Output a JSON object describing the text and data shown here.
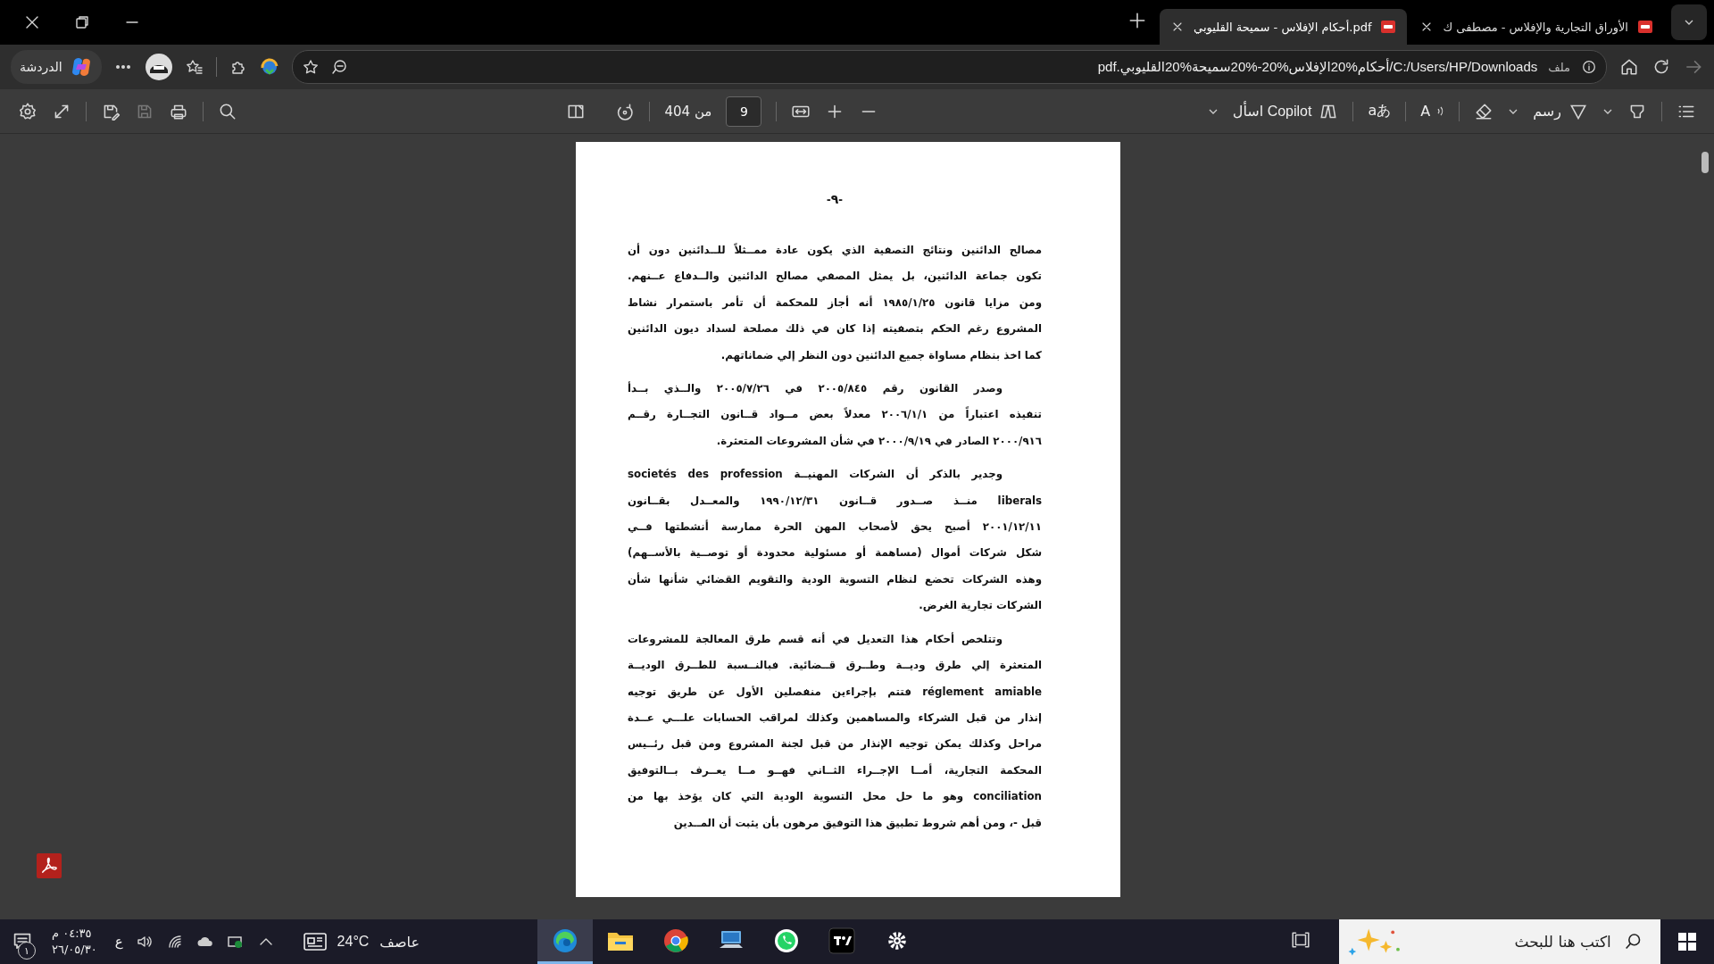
{
  "tabs": [
    {
      "title": "الأوراق التجارية والإفلاس - مصطفى ك",
      "selected": false
    },
    {
      "title": "أحكام الإفلاس - سميحة القليوبي.pdf",
      "selected": true
    }
  ],
  "address_bar": {
    "chat_label": "الدردشة",
    "url": "C:/Users/HP/Downloads/أحكام%20الإفلاس%20-%20سميحة%20القليوبي.pdf",
    "scheme_label": "ملف",
    "forward_disabled": true
  },
  "pdf_toolbar": {
    "save_disabled": true,
    "page_total": "من 404",
    "page_value": "9",
    "copilot_label": "اسأل Copilot",
    "translate_label": "aあ",
    "read_aloud_label": "A",
    "draw_label": "رسم"
  },
  "document": {
    "page_number": "-٩-",
    "paragraphs": [
      {
        "indent": false,
        "lines": [
          "مصالح الدائنين ونتائج التصفية الذي يكون عادة ممــثلاً للــدائنين دون أن",
          "تكون جماعة الدائنين، بل يمثل المصفي مصالح الدائنين والــدفاع عــنهم.",
          "ومن مزايا قانون ١٩٨٥/١/٢٥ أنه أجاز للمحكمة أن تأمر باستمرار نشاط",
          "المشروع رغم الحكم بتصفيته إذا كان في ذلك مصلحة لسداد ديون الدائنين",
          "كما اخذ بنظام مساواة جميع الدائنين دون النظر إلي ضماناتهم."
        ]
      },
      {
        "indent": true,
        "lines": [
          "وصدر القانون رقم ٢٠٠٥/٨٤٥ في ٢٠٠٥/٧/٢٦ والــذي بــدأ",
          "تنفيذه اعتباراً من ٢٠٠٦/١/١ معدلاً بعض مــواد قــانون التجــارة رقــم",
          "٢٠٠٠/٩١٦ الصادر في ٢٠٠٠/٩/١٩ في شأن المشروعات المتعثرة."
        ]
      },
      {
        "indent": true,
        "lines": [
          "وجدير بالذكر أن الشركات المهنيــة  societés des profession",
          "liberals منــذ صــدور قــانون ١٩٩٠/١٢/٣١ والمعــدل بقــانون",
          "٢٠٠١/١٢/١١ أصبح يحق لأصحاب المهن الحرة ممارسة أنشطتها فــي",
          "شكل شركات أموال (مساهمة أو مسئولية محدودة أو توصــية بالأســهم)",
          "وهذه الشركات تخضع لنظام التسوية الودية والتقويم القضائي شأنها شأن",
          "الشركات تجارية الغرض."
        ]
      },
      {
        "indent": true,
        "lines": [
          "وتتلخص أحكام هذا التعديل في أنه قسم طرق المعالجة للمشروعات",
          "المتعثرة إلي طرق وديــة وطــرق قــضائية. فبالنــسبة للطــرق الوديــة",
          "réglement amiable فتتم بإجراءين منفصلين الأول عن طريق توجيه",
          "إنذار من قبل الشركاء والمساهمين وكذلك لمراقب الحسابات علـــي عــدة",
          "مراحل وكذلك يمكن توجيه الإنذار من قبل لجنة المشروع ومن قبل رئــيس",
          "المحكمة التجارية، أمــا الإجــراء الثــاني فهــو مــا يعــرف بــالتوفيق",
          "conciliation وهو ما حل محل التسوية الودية التي كان يؤخذ بها من",
          "قبل -، ومن أهم شروط تطبيق هذا التوفيق مرهون بأن يثبت أن المــدين"
        ]
      }
    ]
  },
  "taskbar": {
    "notification_count": "١",
    "time": "٠٤:٣٥ م",
    "date": "٢٦/٠٥/٣٠",
    "language": "ع",
    "weather_temp": "24°C",
    "weather_label": "عاصف",
    "apps": [
      {
        "kind": "edge",
        "selected": true
      },
      {
        "kind": "explorer",
        "selected": false
      },
      {
        "kind": "chrome",
        "selected": false
      },
      {
        "kind": "computer",
        "selected": false
      },
      {
        "kind": "whatsapp",
        "selected": false
      },
      {
        "kind": "chart",
        "selected": false
      },
      {
        "kind": "settings",
        "selected": false
      }
    ],
    "search_placeholder": "اكتب هنا للبحث"
  }
}
